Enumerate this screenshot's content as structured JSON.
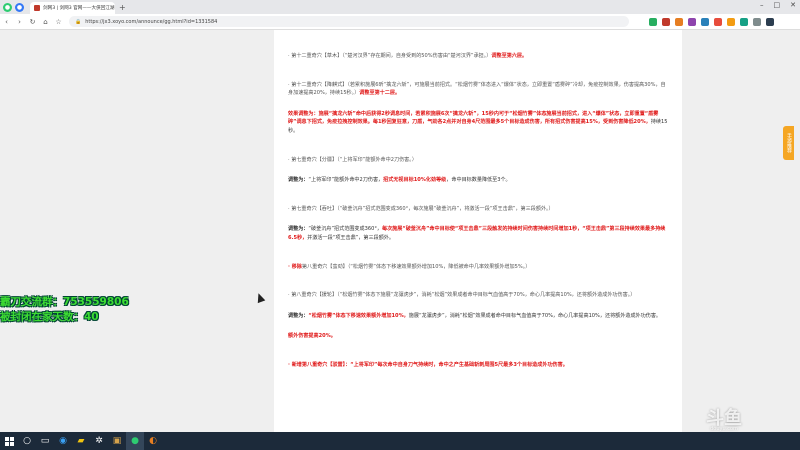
{
  "browser": {
    "tab_title": "剑网3 | 剑网3 官网——大侠回江湖",
    "url": "https://jx3.xoyo.com/announce/gg.html?id=1331584",
    "accent": "#f5a623"
  },
  "article": {
    "p1_prefix": "· 第十二重奇穴【草木】（“楚河汉界”存在期间，自身受到的50%伤害由“楚河汉界”承担。）",
    "p1_red": "调整至第六层。",
    "p2_prefix": "· 第十二重奇穴【降麒式】（若累积施展6昕“擒龙六斩”，可施展当前招式。“松烟竹雾”体态进入“爆体”状态，立即重置“盾雾碎”冷却，免疫控制效果，伤害提高30%，自身加速提高20%，持续15秒。）",
    "p2_red": "调整至第十二层。",
    "p3_label": "效果调整为：",
    "p3_red": "施展“擒龙六斩”命中后获得2秒调息时间，若累积施展6次“擒龙六斩”，15秒内可于“松烟竹雾”体态施展当前招式，进入“爆体”状态，立即重置“盾雾碎”调息下招式，免疫拉拽控制效果。每1秒回复狂意，刀盾，气劲各2点并对自身4尺范围最多5个目标造成伤害，所有招式伤害提高15%，受到伤害降低20%，",
    "p3_tail": "持续15秒。",
    "p4": "· 第七重奇穴【分疆】（“上将军印”能额外命中2刀伤害。）",
    "p5_label": "调整为：",
    "p5_dark1": "“上将军印”能额外命中2刀伤害，",
    "p5_red": "招式无视目标10%化劲等级",
    "p5_dark2": "，命中目标数量降低至3个。",
    "p6": "· 第七重奇穴【吞吐】（“破釜沉舟”招式范围变成360°，每次施展“破釜沉舟”，将激活一段“项王击鼎”，第三段额外。）",
    "p7_label": "调整为：",
    "p7_dark1": "“破釜沉舟”招式范围变成360°，",
    "p7_red": "每次施展“破釜沉舟”命中目标使“项王击鼎”三段触发的持续时间伤害持续时间增加1秒，“项王击鼎”第三段持续效果最多持续6.5秒，",
    "p7_dark2": "并激活一段“项王击鼎”，第三段额外。",
    "p8_red": "· 移除",
    "p8_rest": "第八重奇穴【蛮劲】（“松烟竹雾”体态下移速效果额外增加10%，降低被命中几率效果额外增加5%。）",
    "p9": "· 第八重奇穴【援轮】（“松烟竹雾”体态下施展“龙骧虎步”，消耗“松烟”效果成者命中目标气血值高于70%，命心几率提高10%，还将额外造成外功伤害。）",
    "p10_label": "调整为：",
    "p10_red": "“松烟竹雾”体态下移速效果额外增加10%，",
    "p10_dark": "施展“龙骧虎步”，消耗“松烟”效果成者命中目标气血值高于70%，命心几率提高10%，还将额外造成外功伤害。",
    "p11_red": "额外伤害提高20%。",
    "p12_red": "· 新增第八重奇穴【驳雷】：“上将军印”每次命中自身刀气持续时，命中之产生基础斩刺周围5尺最多3个目标造成外功伤害。"
  },
  "side_tab": "手游推荐",
  "overlay": {
    "line1": "霸刀交流群：753559806",
    "line2": "被封闭在家天数：40",
    "color": "#3ddc33"
  },
  "watermark": {
    "title": "斗鱼",
    "sub": "douyu.com"
  }
}
